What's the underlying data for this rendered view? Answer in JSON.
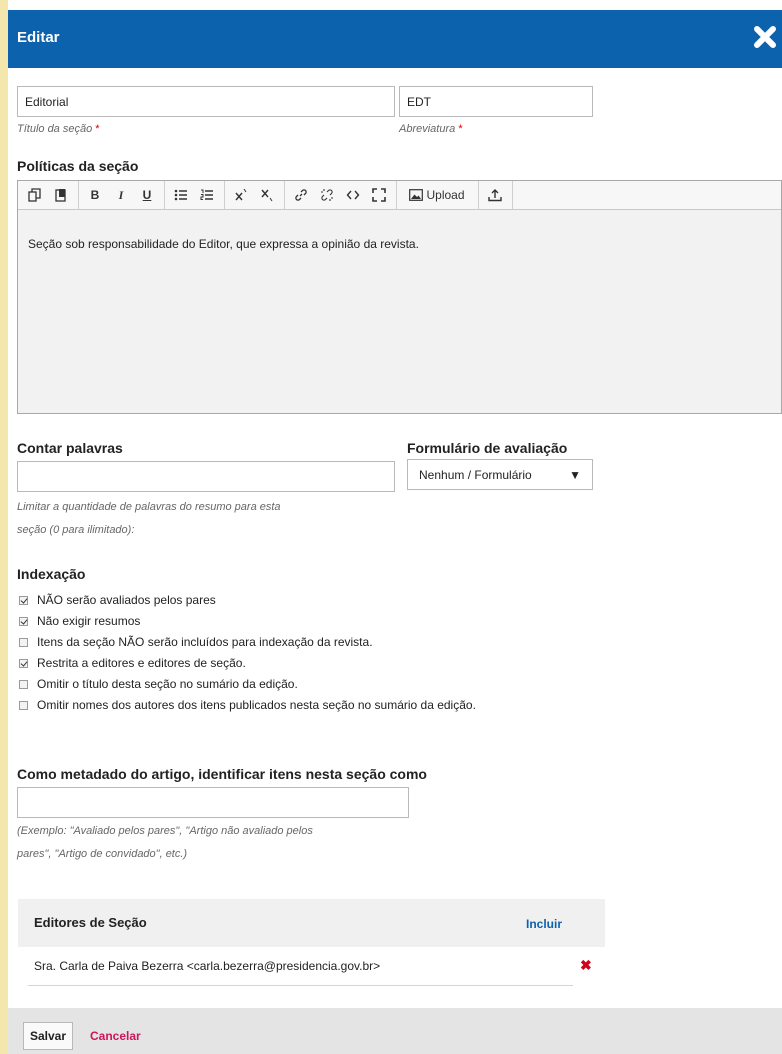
{
  "modal": {
    "title": "Editar",
    "close_icon": "close-icon"
  },
  "section_title": {
    "value": "Editorial",
    "hint": "Título da seção",
    "required": "*"
  },
  "abbreviation": {
    "value": "EDT",
    "hint": "Abreviatura",
    "required": "*"
  },
  "policies": {
    "label": "Políticas da seção",
    "toolbar": {
      "copy_icon": "copy-icon",
      "paste_icon": "paste-icon",
      "bold": "B",
      "italic": "I",
      "underline": "U",
      "bullet_list_icon": "bullet-list-icon",
      "numbered_list_icon": "numbered-list-icon",
      "superscript_icon": "superscript-icon",
      "subscript_icon": "subscript-icon",
      "link_icon": "link-icon",
      "unlink_icon": "unlink-icon",
      "code_icon": "code-icon",
      "fullscreen_icon": "fullscreen-icon",
      "upload_label": "Upload",
      "upload_file_icon": "upload-icon"
    },
    "content": "Seção sob responsabilidade do Editor, que expressa a opinião da revista."
  },
  "word_count": {
    "label": "Contar palavras",
    "value": "",
    "hint_line1": "Limitar a quantidade de palavras do resumo para esta",
    "hint_line2": "seção (0 para ilimitado):"
  },
  "review_form": {
    "label": "Formulário de avaliação",
    "selected": "Nenhum / Formulário",
    "arrow": "▼"
  },
  "indexing": {
    "label": "Indexação",
    "options": [
      {
        "label": "NÃO serão avaliados pelos pares",
        "checked": true
      },
      {
        "label": "Não exigir resumos",
        "checked": true
      },
      {
        "label": "Itens da seção NÃO serão incluídos para indexação da revista.",
        "checked": false
      },
      {
        "label": "Restrita a editores e editores de seção.",
        "checked": true
      },
      {
        "label": "Omitir o título desta seção no sumário da edição.",
        "checked": false
      },
      {
        "label": "Omitir nomes dos autores dos itens publicados nesta seção no sumário da edição.",
        "checked": false
      }
    ]
  },
  "metadata": {
    "label": "Como metadado do artigo, identificar itens nesta seção como",
    "value": "",
    "hint_line1": "(Exemplo: \"Avaliado pelos pares\", \"Artigo não avaliado pelos",
    "hint_line2": "pares\", \"Artigo de convidado\", etc.)"
  },
  "section_editors": {
    "title": "Editores de Seção",
    "add_label": "Incluir",
    "items": [
      {
        "name": "Sra. Carla de Paiva Bezerra <carla.bezerra@presidencia.gov.br>",
        "remove": "✖"
      }
    ]
  },
  "footer": {
    "save_label": "Salvar",
    "cancel_label": "Cancelar"
  },
  "colors": {
    "header": "#0d62ad",
    "page_bg": "#f4e7ae",
    "danger": "#d0021b",
    "cancel": "#d0145a"
  }
}
